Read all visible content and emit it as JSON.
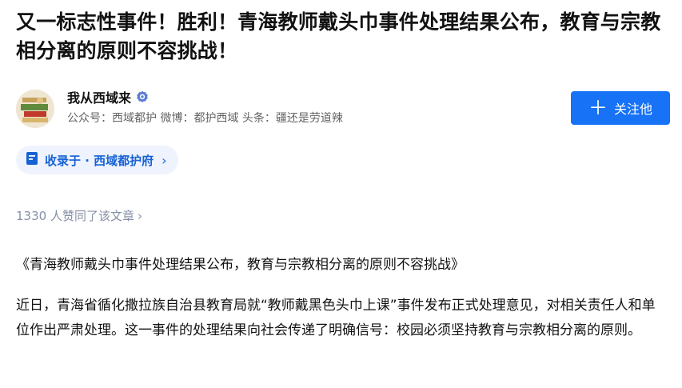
{
  "article": {
    "title": "又一标志性事件！胜利！青海教师戴头巾事件处理结果公布，教育与宗教相分离的原则不容挑战！"
  },
  "author": {
    "name": "我从西域来",
    "description": "公众号：西域都护 微博：都护西域 头条：疆还是劳道辣",
    "verified_icon": "verified-badge-icon",
    "follow_label": "关注他"
  },
  "collection": {
    "label": "收录于 · 西域都护府",
    "chevron": "›"
  },
  "likes": {
    "text": "1330 人赞同了该文章",
    "chevron": "›"
  },
  "content": {
    "paragraphs": [
      "《青海教师戴头巾事件处理结果公布，教育与宗教相分离的原则不容挑战》",
      "近日，青海省循化撒拉族自治县教育局就“教师戴黑色头巾上课”事件发布正式处理意见，对相关责任人和单位作出严肃处理。这一事件的处理结果向社会传递了明确信号：校园必须坚持教育与宗教相分离的原则。"
    ]
  },
  "colors": {
    "accent": "#1772f6",
    "collection_bg": "#eef3fd",
    "collection_text": "#1762d5",
    "muted": "#8590a6"
  }
}
